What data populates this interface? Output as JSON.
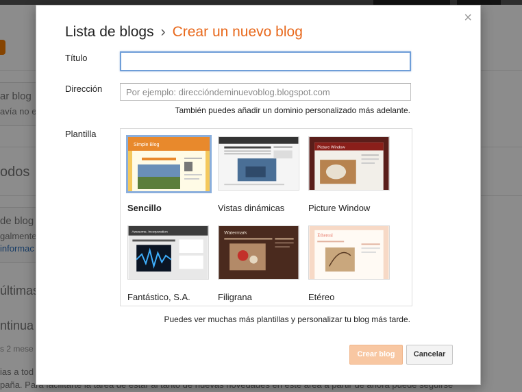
{
  "background": {
    "snippets": [
      "ar blog",
      "avía no e",
      "odos",
      "de blog",
      "galmente",
      "informac",
      "últimas",
      "ntinua",
      "s 2 mese",
      "ias a tod",
      "paña. Para facilitarte la tarea de estar al tanto de nuevas novedades en este área a partir de ahora puede seguirse"
    ]
  },
  "dialog": {
    "close_symbol": "×",
    "breadcrumb": {
      "parent": "Lista de blogs",
      "separator": "›",
      "current": "Crear un nuevo blog"
    },
    "title_label": "Título",
    "title_value": "",
    "address_label": "Dirección",
    "address_placeholder": "Por ejemplo: direccióndeminuevoblog.blogspot.com",
    "address_hint": "También puedes añadir un dominio personalizado más adelante.",
    "template_label": "Plantilla",
    "templates": [
      {
        "name": "Sencillo",
        "selected": true,
        "thumb_title": "Simple Blog"
      },
      {
        "name": "Vistas dinámicas",
        "selected": false,
        "thumb_title": ""
      },
      {
        "name": "Picture Window",
        "selected": false,
        "thumb_title": "Picture Window"
      },
      {
        "name": "Fantástico, S.A.",
        "selected": false,
        "thumb_title": "Awesome, Incorporation"
      },
      {
        "name": "Filigrana",
        "selected": false,
        "thumb_title": "Watermark"
      },
      {
        "name": "Etéreo",
        "selected": false,
        "thumb_title": "Ethereal"
      }
    ],
    "templates_hint": "Puedes ver muchas más plantillas y personalizar tu blog más tarde.",
    "create_button": "Crear blog",
    "cancel_button": "Cancelar"
  },
  "colors": {
    "accent": "#e8681b",
    "create_button_bg": "#f8c7a2",
    "selected_border": "#8aaedc",
    "focus_border": "#6f9ed8"
  }
}
